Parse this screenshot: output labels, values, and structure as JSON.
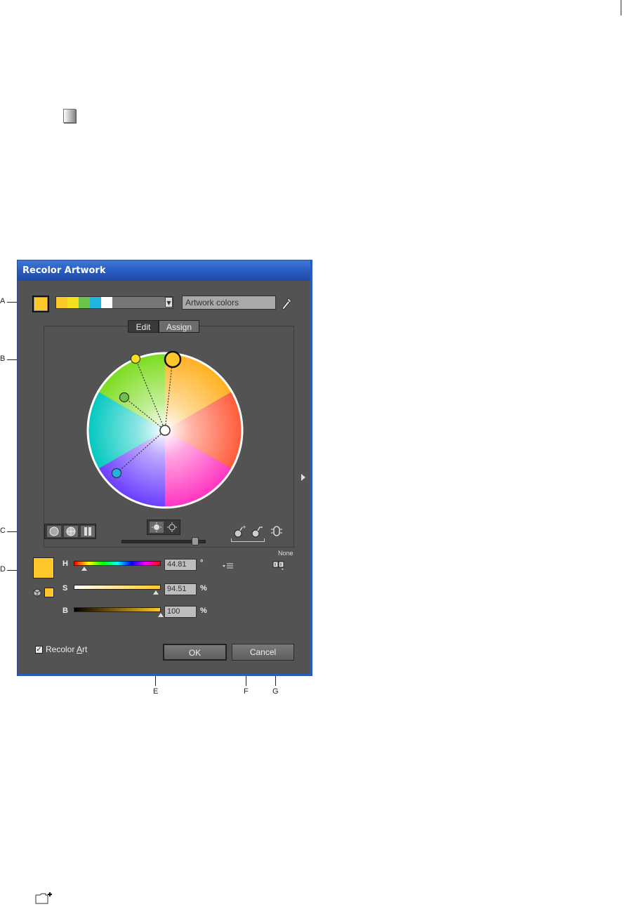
{
  "dialog": {
    "title": "Recolor Artwork",
    "color_group_strip": [
      "#ffc82a",
      "#f5de1c",
      "#6cc24a",
      "#20b4e0",
      "#ffffff"
    ],
    "group_name": "Artwork colors",
    "tabs": {
      "edit": "Edit",
      "assign": "Assign"
    },
    "limit_label": "None",
    "sliders": {
      "h": {
        "label": "H",
        "value": "44.81",
        "unit": "°",
        "level": 0.12
      },
      "s": {
        "label": "S",
        "value": "94.51",
        "unit": "%",
        "level": 0.9451
      },
      "b": {
        "label": "B",
        "value": "100",
        "unit": "%",
        "level": 1.0
      }
    },
    "recolor_art": {
      "label_prefix": "Recolor ",
      "label_access": "A",
      "label_suffix": "rt",
      "checked": true
    },
    "buttons": {
      "ok": "OK",
      "cancel": "Cancel"
    },
    "base_color": "#ffc82a"
  },
  "callouts": [
    "A",
    "B",
    "C",
    "D",
    "E",
    "F",
    "G"
  ]
}
